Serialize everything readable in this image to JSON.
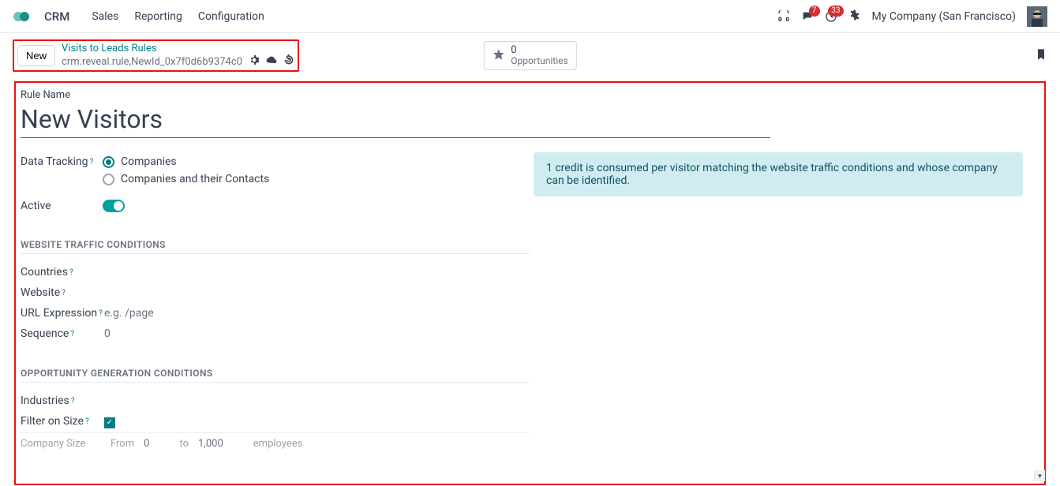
{
  "nav": {
    "app": "CRM",
    "menu": [
      "Sales",
      "Reporting",
      "Configuration"
    ],
    "chat_count": "7",
    "activity_count": "33",
    "company": "My Company (San Francisco)"
  },
  "cp": {
    "new_btn": "New",
    "breadcrumb_top": "Visits to Leads Rules",
    "breadcrumb_bot": "crm.reveal.rule,NewId_0x7f0d6b9374c0",
    "stat_num": "0",
    "stat_label": "Opportunities"
  },
  "form": {
    "rule_name_label": "Rule Name",
    "rule_name_value": "New Visitors",
    "data_tracking_label": "Data Tracking",
    "radio1": "Companies",
    "radio2": "Companies and their Contacts",
    "active_label": "Active",
    "info": "1 credit is consumed per visitor matching the website traffic conditions and whose company can be identified.",
    "section1": "WEBSITE TRAFFIC CONDITIONS",
    "countries_label": "Countries",
    "website_label": "Website",
    "url_label": "URL Expression",
    "url_placeholder": "e.g. /page",
    "sequence_label": "Sequence",
    "sequence_value": "0",
    "section2": "OPPORTUNITY GENERATION CONDITIONS",
    "industries_label": "Industries",
    "filter_size_label": "Filter on Size",
    "company_size_label": "Company Size",
    "size_from": "From",
    "size_from_val": "0",
    "size_to": "to",
    "size_to_val": "1,000",
    "size_emp": "employees"
  }
}
